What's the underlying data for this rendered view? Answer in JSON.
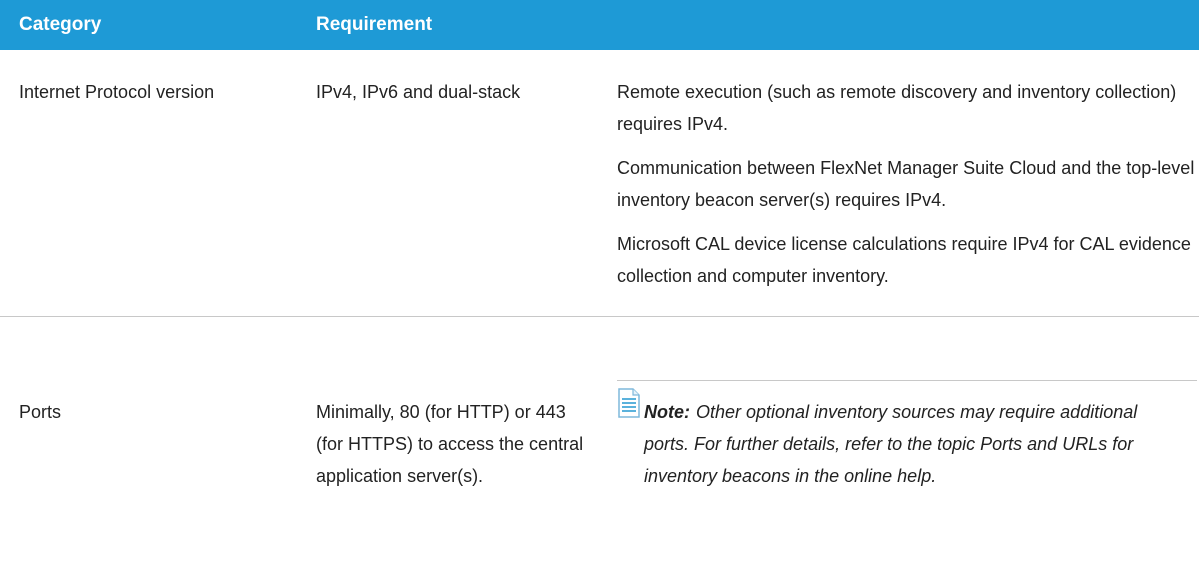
{
  "header": {
    "col_category": "Category",
    "col_requirement": "Requirement"
  },
  "rows": [
    {
      "category": "Internet Protocol version",
      "requirement": "IPv4, IPv6 and dual-stack",
      "notes": [
        "Remote execution (such as remote discovery and inventory collection) requires IPv4.",
        "Communication between FlexNet Manager Suite Cloud and the top-level inventory beacon server(s) requires IPv4.",
        "Microsoft CAL device license calculations require IPv4 for CAL evidence collection and computer inventory."
      ]
    },
    {
      "category": "Ports",
      "requirement": "Minimally, 80 (for HTTP) or 443 (for HTTPS) to access the central application server(s).",
      "note": {
        "label": "Note:",
        "icon": "note-document-icon",
        "text": "Other optional inventory sources may require additional ports. For further details, refer to the topic Ports and URLs for inventory beacons in the online help."
      }
    }
  ],
  "colors": {
    "header_bg": "#1e9ad6",
    "header_text": "#ffffff",
    "divider": "#c8c8c8",
    "icon": "#5bb2dc"
  }
}
